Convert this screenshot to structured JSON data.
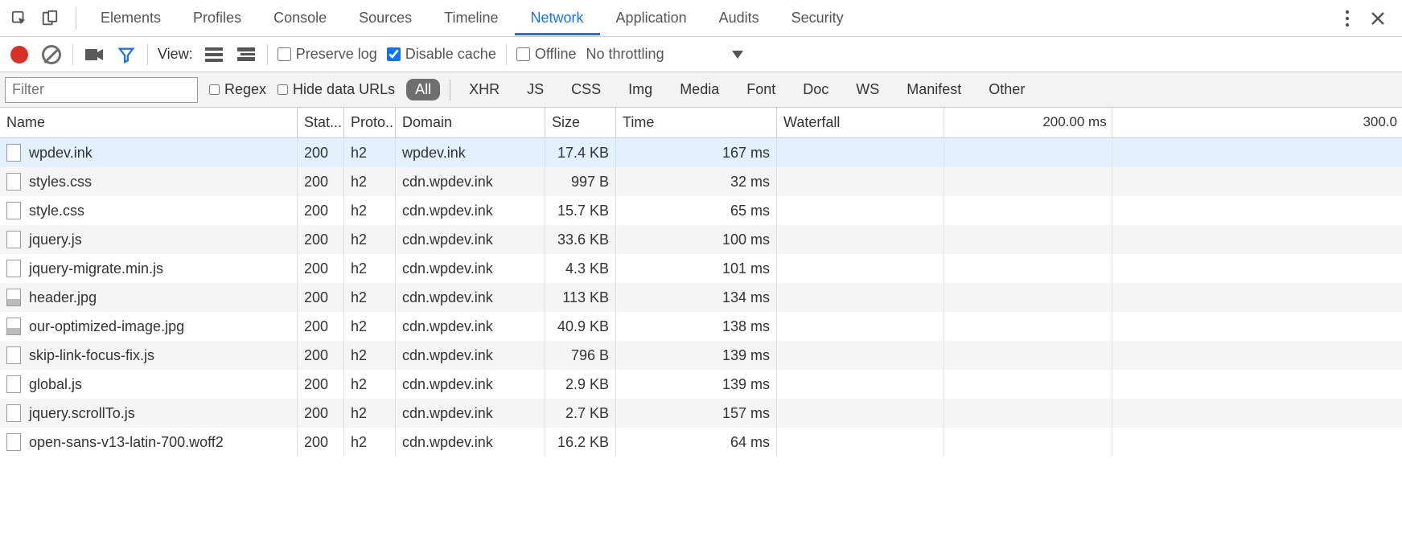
{
  "tabs": {
    "inspect_icon": "inspect-icon",
    "device_icon": "device-icon",
    "items": [
      "Elements",
      "Profiles",
      "Console",
      "Sources",
      "Timeline",
      "Network",
      "Application",
      "Audits",
      "Security"
    ],
    "active": "Network"
  },
  "toolbar": {
    "view_label": "View:",
    "preserve_log": "Preserve log",
    "disable_cache": "Disable cache",
    "disable_cache_checked": true,
    "offline": "Offline",
    "throttle": "No throttling"
  },
  "filterbar": {
    "filter_placeholder": "Filter",
    "regex": "Regex",
    "hide_data_urls": "Hide data URLs",
    "types": [
      "All",
      "XHR",
      "JS",
      "CSS",
      "Img",
      "Media",
      "Font",
      "Doc",
      "WS",
      "Manifest",
      "Other"
    ],
    "active_type": "All"
  },
  "columns": {
    "name": "Name",
    "status": "Stat...",
    "protocol": "Proto..",
    "domain": "Domain",
    "size": "Size",
    "time": "Time",
    "waterfall": "Waterfall"
  },
  "waterfall": {
    "ticks": [
      {
        "ms": 100,
        "label": "",
        "pct": 26.7
      },
      {
        "ms": 200,
        "label": "200.00 ms",
        "pct": 53.5
      },
      {
        "ms": 300,
        "label": "300.0",
        "pct": 100.0
      }
    ]
  },
  "rows": [
    {
      "name": "wpdev.ink",
      "status": "200",
      "protocol": "h2",
      "domain": "wpdev.ink",
      "size": "17.4 KB",
      "time": "167 ms",
      "icon": "doc",
      "selected": true,
      "bar": {
        "start": 0.4,
        "wait": 0.6,
        "content": 23.0,
        "done": 23.0
      }
    },
    {
      "name": "styles.css",
      "status": "200",
      "protocol": "h2",
      "domain": "cdn.wpdev.ink",
      "size": "997 B",
      "time": "32 ms",
      "icon": "doc",
      "bar": {
        "start": 25.3,
        "wait": 0.8,
        "content": 8.0,
        "done": 1.2
      }
    },
    {
      "name": "style.css",
      "status": "200",
      "protocol": "h2",
      "domain": "cdn.wpdev.ink",
      "size": "15.7 KB",
      "time": "65 ms",
      "icon": "doc",
      "bar": {
        "start": 25.3,
        "wait": 0.8,
        "content": 16.5,
        "done": 0.5
      }
    },
    {
      "name": "jquery.js",
      "status": "200",
      "protocol": "h2",
      "domain": "cdn.wpdev.ink",
      "size": "33.6 KB",
      "time": "100 ms",
      "icon": "doc",
      "bar": {
        "start": 25.3,
        "wait": 0.8,
        "content": 18.5,
        "done": 8.0
      }
    },
    {
      "name": "jquery-migrate.min.js",
      "status": "200",
      "protocol": "h2",
      "domain": "cdn.wpdev.ink",
      "size": "4.3 KB",
      "time": "101 ms",
      "icon": "doc",
      "bar": {
        "start": 25.3,
        "wait": 0.8,
        "content": 26.5,
        "done": 0.6
      }
    },
    {
      "name": "header.jpg",
      "status": "200",
      "protocol": "h2",
      "domain": "cdn.wpdev.ink",
      "size": "113 KB",
      "time": "134 ms",
      "icon": "img",
      "bar": {
        "start": 25.3,
        "wait": 0.8,
        "content": 27.0,
        "done": 9.0
      }
    },
    {
      "name": "our-optimized-image.jpg",
      "status": "200",
      "protocol": "h2",
      "domain": "cdn.wpdev.ink",
      "size": "40.9 KB",
      "time": "138 ms",
      "icon": "img",
      "bar": {
        "start": 25.3,
        "wait": 0.8,
        "content": 36.5,
        "done": 0.6
      }
    },
    {
      "name": "skip-link-focus-fix.js",
      "status": "200",
      "protocol": "h2",
      "domain": "cdn.wpdev.ink",
      "size": "796 B",
      "time": "139 ms",
      "icon": "doc",
      "bar": {
        "start": 25.3,
        "wait": 0.8,
        "content": 36.5,
        "done": 0.6
      }
    },
    {
      "name": "global.js",
      "status": "200",
      "protocol": "h2",
      "domain": "cdn.wpdev.ink",
      "size": "2.9 KB",
      "time": "139 ms",
      "icon": "doc",
      "bar": {
        "start": 25.3,
        "wait": 0.8,
        "content": 37.0,
        "done": 0.6
      }
    },
    {
      "name": "jquery.scrollTo.js",
      "status": "200",
      "protocol": "h2",
      "domain": "cdn.wpdev.ink",
      "size": "2.7 KB",
      "time": "157 ms",
      "icon": "doc",
      "bar": {
        "start": 25.3,
        "wait": 0.8,
        "content": 41.5,
        "done": 0.6
      }
    },
    {
      "name": "open-sans-v13-latin-700.woff2",
      "status": "200",
      "protocol": "h2",
      "domain": "cdn.wpdev.ink",
      "size": "16.2 KB",
      "time": "64 ms",
      "icon": "doc",
      "bar": {
        "start": 58.5,
        "wait": 0.8,
        "content": 14.5,
        "done": 0
      }
    }
  ]
}
